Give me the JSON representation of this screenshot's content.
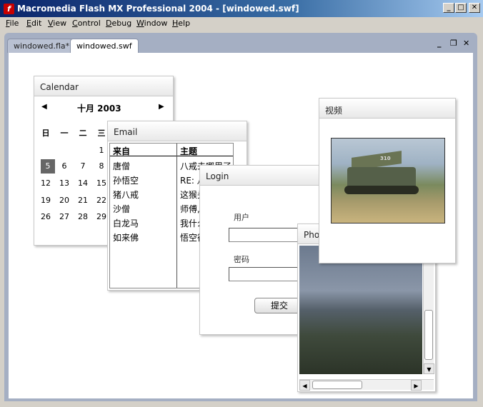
{
  "window": {
    "title": "Macromedia Flash MX Professional 2004 - [windowed.swf]"
  },
  "menu": [
    "File",
    "Edit",
    "View",
    "Control",
    "Debug",
    "Window",
    "Help"
  ],
  "tabs": [
    {
      "label": "windowed.fla*",
      "active": false
    },
    {
      "label": "windowed.swf",
      "active": true
    }
  ],
  "calendar": {
    "title": "Calendar",
    "month": "十月 2003",
    "weekdays": [
      "日",
      "一",
      "二",
      "三"
    ],
    "days": [
      [
        "",
        "",
        "",
        "1"
      ],
      [
        "5",
        "6",
        "7",
        "8"
      ],
      [
        "12",
        "13",
        "14",
        "15"
      ],
      [
        "19",
        "20",
        "21",
        "22"
      ],
      [
        "26",
        "27",
        "28",
        "29"
      ]
    ],
    "selected": "5"
  },
  "email": {
    "title": "Email",
    "headers": [
      "来自",
      "主题"
    ],
    "rows": [
      [
        "唐僧",
        "八戒去哪里了"
      ],
      [
        "孙悟空",
        "RE: 八"
      ],
      [
        "猪八戒",
        "这猴头"
      ],
      [
        "沙僧",
        "师傅,"
      ],
      [
        "白龙马",
        "我什么"
      ],
      [
        "如来佛",
        "悟空往"
      ]
    ]
  },
  "login": {
    "title": "Login",
    "user_label": "用户",
    "password_label": "密码",
    "submit_label": "提交",
    "user_value": "",
    "password_value": ""
  },
  "photo": {
    "title": "Photo"
  },
  "video": {
    "title": "视频",
    "tank_marking": "310"
  },
  "colors": {
    "titlebar": "#0a246a",
    "selected_day": "#666666",
    "mdi_bg": "#a5afc3"
  }
}
